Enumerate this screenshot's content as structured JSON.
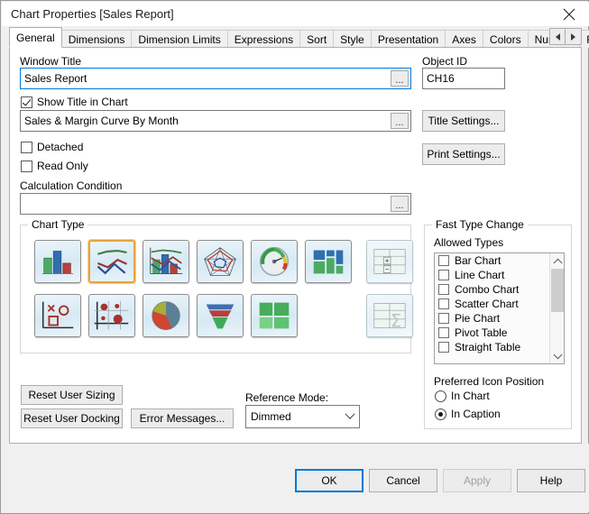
{
  "window": {
    "title": "Chart Properties [Sales Report]",
    "close_icon": "close-icon"
  },
  "tabs": {
    "items": [
      {
        "label": "General",
        "selected": true
      },
      {
        "label": "Dimensions",
        "selected": false
      },
      {
        "label": "Dimension Limits",
        "selected": false
      },
      {
        "label": "Expressions",
        "selected": false
      },
      {
        "label": "Sort",
        "selected": false
      },
      {
        "label": "Style",
        "selected": false
      },
      {
        "label": "Presentation",
        "selected": false
      },
      {
        "label": "Axes",
        "selected": false
      },
      {
        "label": "Colors",
        "selected": false
      },
      {
        "label": "Number",
        "selected": false
      },
      {
        "label": "Font",
        "selected": false
      }
    ],
    "scroll_prev_icon": "triangle-left-icon",
    "scroll_next_icon": "triangle-right-icon"
  },
  "general": {
    "window_title_label": "Window Title",
    "window_title_value": "Sales Report",
    "window_title_ellipsis": "...",
    "object_id_label": "Object ID",
    "object_id_value": "CH16",
    "show_title_label": "Show Title in Chart",
    "show_title_checked": true,
    "chart_title_value": "Sales & Margin Curve By Month",
    "chart_title_ellipsis": "...",
    "title_settings_label": "Title Settings...",
    "print_settings_label": "Print Settings...",
    "detached_label": "Detached",
    "detached_checked": false,
    "read_only_label": "Read Only",
    "read_only_checked": false,
    "calculation_condition_label": "Calculation Condition",
    "calculation_condition_value": "",
    "calculation_condition_ellipsis": "..."
  },
  "chart_type": {
    "group_title": "Chart Type",
    "row1": [
      {
        "name": "bar-chart",
        "selected": false
      },
      {
        "name": "line-chart",
        "selected": true
      },
      {
        "name": "combo-chart",
        "selected": false
      },
      {
        "name": "radar-chart",
        "selected": false
      },
      {
        "name": "gauge-chart",
        "selected": false
      },
      {
        "name": "block-chart",
        "selected": false
      },
      {
        "name": "pivot-table",
        "selected": false
      }
    ],
    "row2": [
      {
        "name": "scatter-chart",
        "selected": false
      },
      {
        "name": "grid-chart",
        "selected": false
      },
      {
        "name": "pie-chart",
        "selected": false
      },
      {
        "name": "funnel-chart",
        "selected": false
      },
      {
        "name": "mekko-chart",
        "selected": false
      },
      {
        "name": "straight-table",
        "selected": false
      }
    ]
  },
  "fast_type_change": {
    "group_title": "Fast Type Change",
    "allowed_types_label": "Allowed Types",
    "allowed_types": [
      {
        "label": "Bar Chart",
        "checked": false
      },
      {
        "label": "Line Chart",
        "checked": false
      },
      {
        "label": "Combo Chart",
        "checked": false
      },
      {
        "label": "Scatter Chart",
        "checked": false
      },
      {
        "label": "Pie Chart",
        "checked": false
      },
      {
        "label": "Pivot Table",
        "checked": false
      },
      {
        "label": "Straight Table",
        "checked": false
      }
    ],
    "preferred_icon_position_label": "Preferred Icon Position",
    "in_chart_label": "In Chart",
    "in_chart_selected": false,
    "in_caption_label": "In Caption",
    "in_caption_selected": true
  },
  "actions": {
    "reset_user_sizing": "Reset User Sizing",
    "reset_user_docking": "Reset User Docking",
    "error_messages": "Error Messages...",
    "reference_mode_label": "Reference Mode:",
    "reference_mode_value": "Dimmed"
  },
  "footer": {
    "ok": "OK",
    "cancel": "Cancel",
    "apply": "Apply",
    "apply_disabled": true,
    "help": "Help"
  },
  "colors": {
    "accent": "#0078d7",
    "selection_border": "#e8a33d",
    "dialog_bg": "#f0f0f0",
    "page_bg": "#ffffff"
  }
}
